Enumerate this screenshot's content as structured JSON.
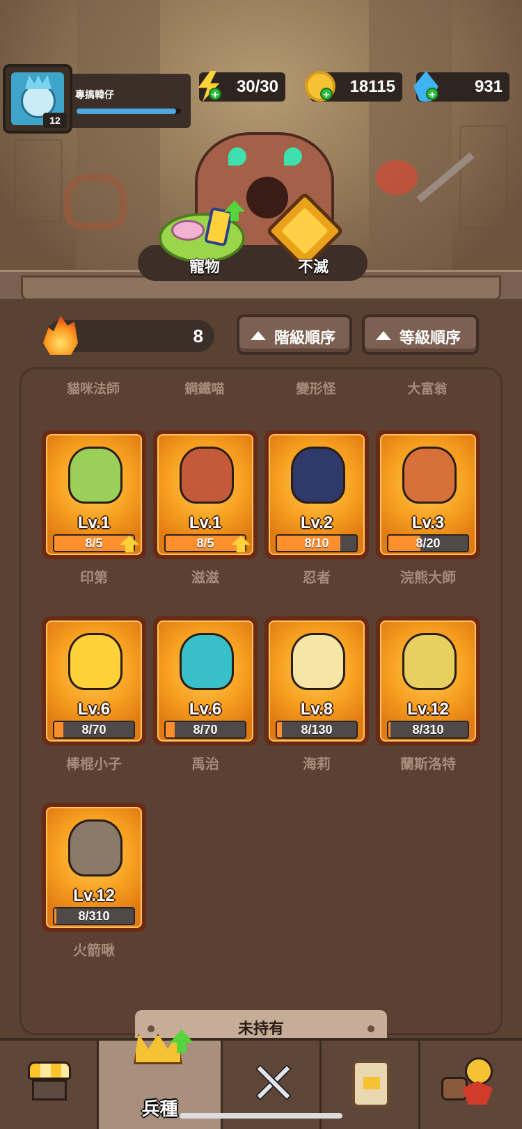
{
  "player": {
    "name": "專搞韓仔",
    "level": "12",
    "xp_fraction": 0.95
  },
  "resources": [
    {
      "name": "energy",
      "icon": "lightning-icon",
      "value": "30/30"
    },
    {
      "name": "gold",
      "icon": "crown-coin-icon",
      "value": "18115"
    },
    {
      "name": "gem",
      "icon": "water-gem-icon",
      "value": "931"
    }
  ],
  "scene_actions": {
    "pet_label": "寵物",
    "immortal_label": "不滅"
  },
  "power": {
    "value": "8"
  },
  "sort": {
    "grade_label": "階級順序",
    "level_label": "等級順序"
  },
  "top_row_names": [
    "貓咪法師",
    "鋼鐵喵",
    "變形怪",
    "大富翁"
  ],
  "units": [
    {
      "name": "印第",
      "level": "Lv.1",
      "progress": "8/5",
      "fill": 1.0,
      "upgradable": true,
      "art": "#9ad05a"
    },
    {
      "name": "滋滋",
      "level": "Lv.1",
      "progress": "8/5",
      "fill": 1.0,
      "upgradable": true,
      "art": "#c45a3a"
    },
    {
      "name": "忍者",
      "level": "Lv.2",
      "progress": "8/10",
      "fill": 0.8,
      "upgradable": false,
      "art": "#2f3a6a"
    },
    {
      "name": "浣熊大師",
      "level": "Lv.3",
      "progress": "8/20",
      "fill": 0.4,
      "upgradable": false,
      "art": "#d8703a"
    },
    {
      "name": "棒棍小子",
      "level": "Lv.6",
      "progress": "8/70",
      "fill": 0.114,
      "upgradable": false,
      "art": "#ffd23a"
    },
    {
      "name": "禹治",
      "level": "Lv.6",
      "progress": "8/70",
      "fill": 0.114,
      "upgradable": false,
      "art": "#38c0c8"
    },
    {
      "name": "海莉",
      "level": "Lv.8",
      "progress": "8/130",
      "fill": 0.062,
      "upgradable": false,
      "art": "#f5e6a8"
    },
    {
      "name": "蘭斯洛特",
      "level": "Lv.12",
      "progress": "8/310",
      "fill": 0.026,
      "upgradable": false,
      "art": "#e8d060"
    },
    {
      "name": "火箭啾",
      "level": "Lv.12",
      "progress": "8/310",
      "fill": 0.026,
      "upgradable": false,
      "art": "#8a7a6a"
    }
  ],
  "unowned_label": "未持有",
  "nav": [
    {
      "id": "shop",
      "label": "",
      "icon": "shop-icon"
    },
    {
      "id": "units",
      "label": "兵種",
      "icon": "crown-icon",
      "active": true
    },
    {
      "id": "battle",
      "label": "",
      "icon": "crossed-swords-icon"
    },
    {
      "id": "cards",
      "label": "",
      "icon": "card-icon"
    },
    {
      "id": "pets",
      "label": "",
      "icon": "pet-icon"
    }
  ]
}
